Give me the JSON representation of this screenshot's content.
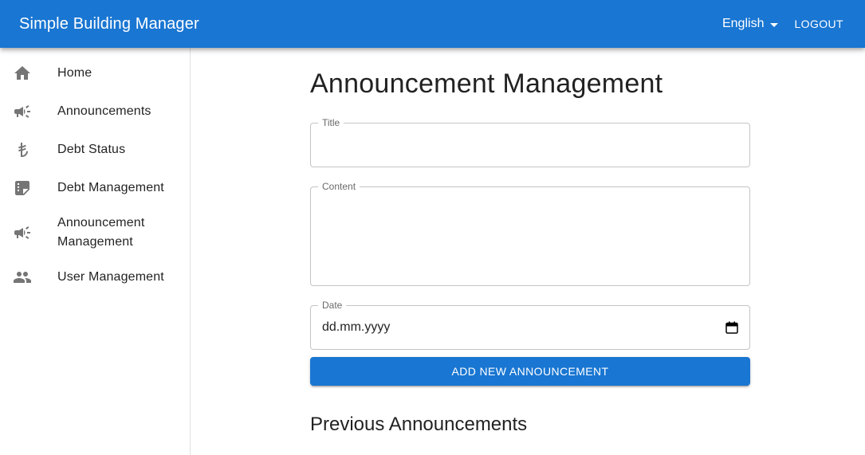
{
  "appbar": {
    "title": "Simple Building Manager",
    "language": "English",
    "logout_label": "LOGOUT"
  },
  "sidebar": {
    "items": [
      {
        "label": "Home",
        "icon": "home-icon"
      },
      {
        "label": "Announcements",
        "icon": "campaign-icon"
      },
      {
        "label": "Debt Status",
        "icon": "lira-icon"
      },
      {
        "label": "Debt Management",
        "icon": "receipt-icon"
      },
      {
        "label": "Announcement Management",
        "icon": "campaign-icon"
      },
      {
        "label": "User Management",
        "icon": "people-icon"
      }
    ]
  },
  "main": {
    "title": "Announcement Management",
    "form": {
      "title_label": "Title",
      "title_value": "",
      "content_label": "Content",
      "content_value": "",
      "date_label": "Date",
      "date_placeholder": "dd.mm.yyyy",
      "submit_label": "ADD NEW ANNOUNCEMENT"
    },
    "previous_title": "Previous Announcements"
  },
  "colors": {
    "primary": "#1976d2",
    "icon": "#757575"
  }
}
